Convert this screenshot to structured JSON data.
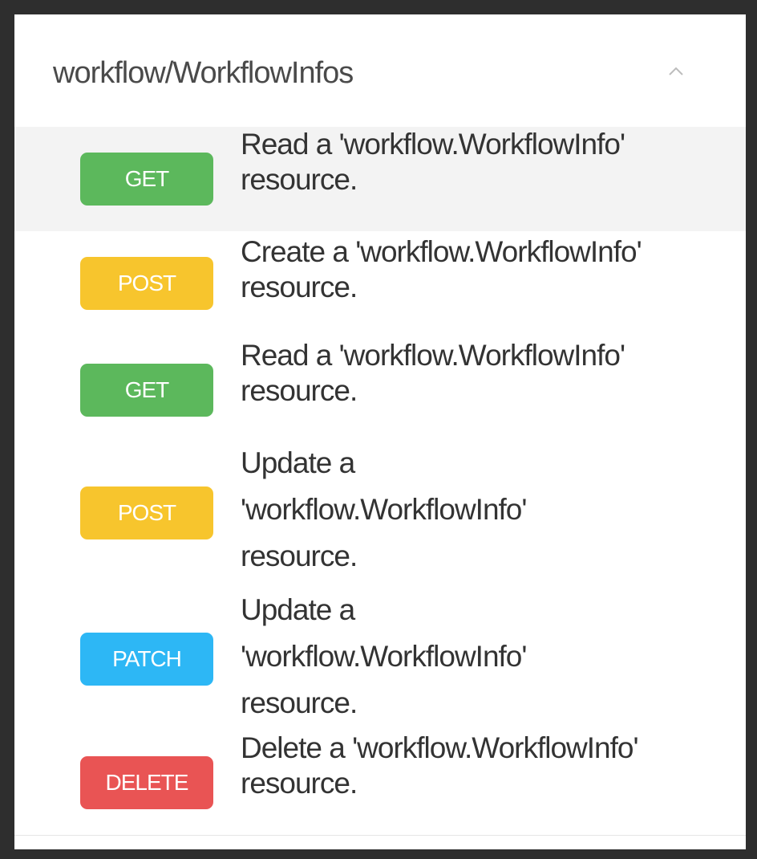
{
  "panel": {
    "title": "workflow/WorkflowInfos",
    "caret_icon": "chevron-up-icon"
  },
  "colors": {
    "GET": "#5cb85c",
    "POST": "#f7c52d",
    "PATCH": "#2db7f5",
    "DELETE": "#e95454"
  },
  "endpoints": [
    {
      "method": "GET",
      "lines": [
        "Read a 'workflow.WorkflowInfo'",
        "resource."
      ]
    },
    {
      "method": "POST",
      "lines": [
        "Create a 'workflow.WorkflowInfo'",
        "resource."
      ]
    },
    {
      "method": "GET",
      "lines": [
        "Read a 'workflow.WorkflowInfo'",
        "resource."
      ]
    },
    {
      "method": "POST",
      "lines": [
        "Update a",
        "'workflow.WorkflowInfo'",
        "resource."
      ]
    },
    {
      "method": "PATCH",
      "lines": [
        "Update a",
        "'workflow.WorkflowInfo'",
        "resource."
      ]
    },
    {
      "method": "DELETE",
      "lines": [
        "Delete a 'workflow.WorkflowInfo'",
        "resource."
      ]
    }
  ]
}
